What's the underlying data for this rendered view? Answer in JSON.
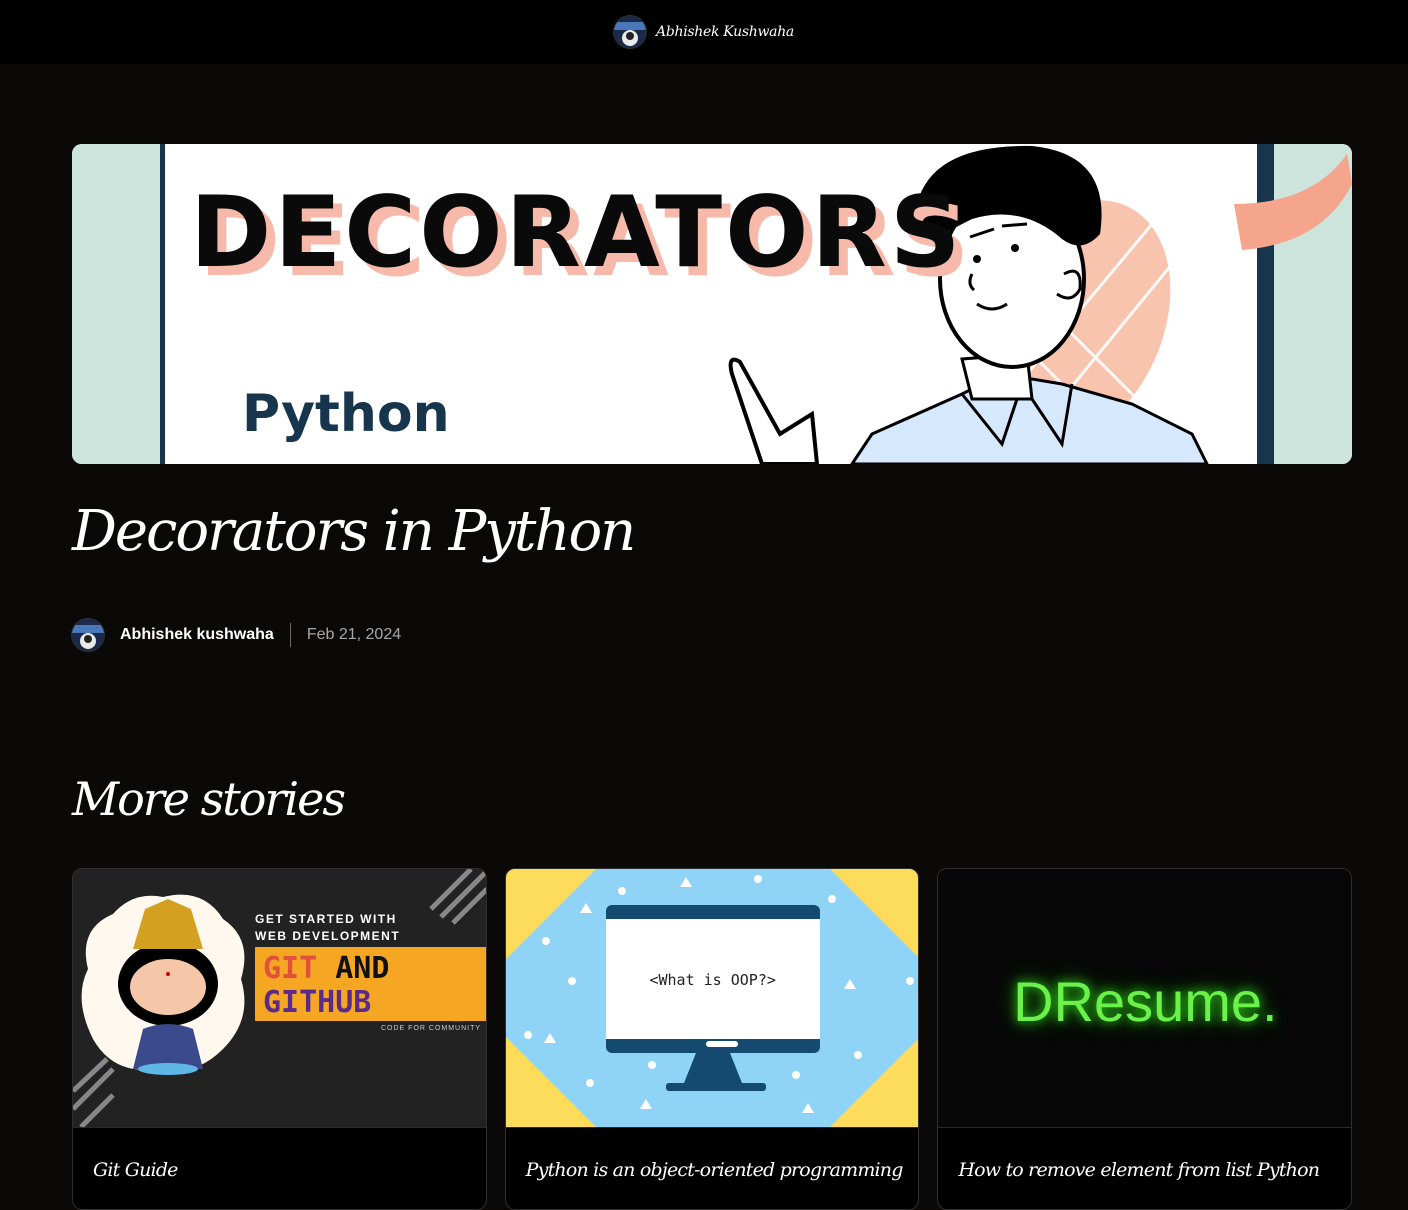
{
  "header": {
    "site_name": "Abhishek Kushwaha"
  },
  "hero": {
    "headline": "DECORATORS",
    "subheadline": "Python"
  },
  "post": {
    "title": "Decorators in Python",
    "author": "Abhishek kushwaha",
    "date": "Feb 21, 2024"
  },
  "more": {
    "heading": "More stories",
    "cards": [
      {
        "title": "Git Guide",
        "image": {
          "line1": "GET STARTED WITH",
          "line2": "WEB DEVELOPMENT",
          "word_git": "GIT",
          "word_and": "AND",
          "word_github": "GITHUB",
          "footer": "CODE FOR COMMUNITY"
        }
      },
      {
        "title": "Python is an object-oriented programming",
        "image": {
          "screen_text": "<What is OOP?>"
        }
      },
      {
        "title": "How to remove element from list Python",
        "image": {
          "logo_text": "DResume."
        }
      }
    ]
  },
  "colors": {
    "background": "#0b0908",
    "topbar": "#000000",
    "hero_mint": "#cde4dd",
    "hero_navy": "#17364d",
    "hero_peach": "#f6b9aa",
    "git_orange": "#f5a623",
    "git_purple": "#5b2b8c",
    "oop_blue": "#8fd3f7",
    "oop_yellow": "#fddc5c",
    "dresume_green": "#6cf04a"
  }
}
